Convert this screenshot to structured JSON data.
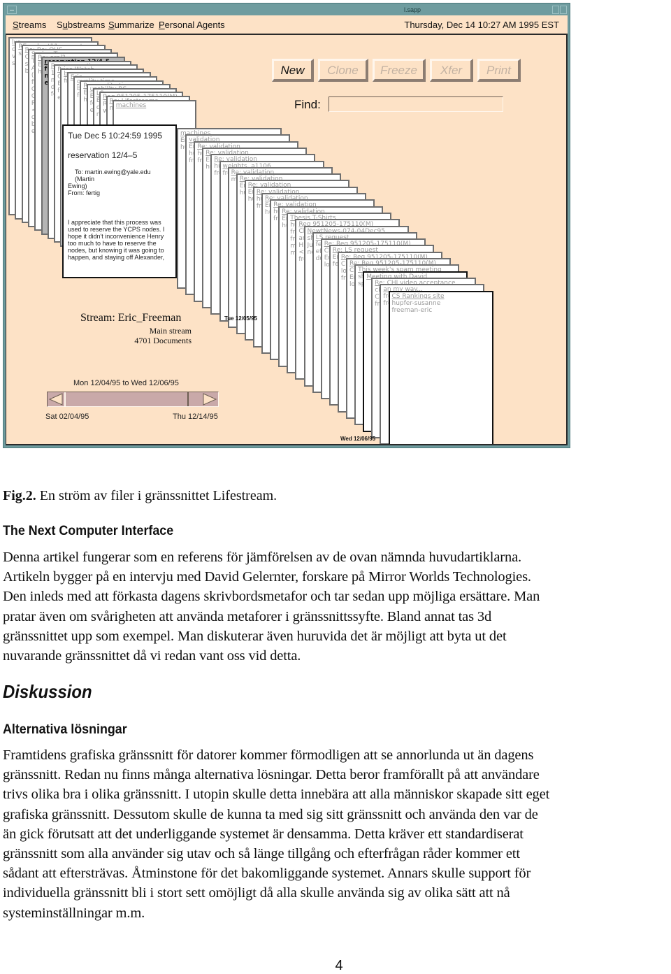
{
  "figure": {
    "window": {
      "title": "l.sapp",
      "menu": [
        {
          "mnemonic": "S",
          "rest": "treams"
        },
        {
          "pre": "S",
          "mnemonic": "u",
          "rest": "bstreams"
        },
        {
          "mnemonic": "S",
          "rest": "ummarize"
        },
        {
          "mnemonic": "P",
          "rest": "ersonal Agents"
        }
      ],
      "clock": "Thursday, Dec 14 10:27 AM 1995 EST"
    },
    "toolbar": {
      "buttons": [
        {
          "label": "New",
          "enabled": true
        },
        {
          "label": "Clone",
          "enabled": false
        },
        {
          "label": "Freeze",
          "enabled": false
        },
        {
          "label": "Xfer",
          "enabled": false
        },
        {
          "label": "Print",
          "enabled": false
        }
      ],
      "find_label": "Find:",
      "find_value": ""
    },
    "stack_cards_past": [
      {
        "lines": [
          "lur",
          "coaler",
          "ve",
          "se"
        ]
      },
      {
        "lines": [
          "RE: robert11 re appt",
          "se wit"
        ]
      },
      {
        "lines": [
          "Re: Re: OUS",
          "Co",
          "sw",
          "be"
        ]
      },
      {
        "lines": [
          "Spring Term",
          "Te",
          "As",
          "(re",
          "fis",
          "CS",
          "Gr",
          "Ra",
          "<ra",
          "cla",
          "bro",
          "exp"
        ]
      },
      {
        "lines": [
          "Re: oral?",
          "Eric",
          "hug"
        ]
      },
      {
        "lines": [
          "reservation 12/4-5",
          "fert",
          "ma",
          "edu"
        ],
        "style": "grey"
      },
      {
        "lines": [
          "Re: reservation",
          "12",
          "ma",
          "da",
          "fe"
        ]
      },
      {
        "lines": [
          "Price Watch",
          "Co",
          "Be",
          "fre",
          "e.a"
        ]
      },
      {
        "lines": [
          "bug",
          "fre"
        ]
      },
      {
        "lines": [
          "Eric"
        ]
      },
      {
        "lines": [
          "quality time",
          "bug",
          "fre"
        ]
      },
      {
        "lines": [
          "Re: quality time",
          "Eric",
          "hug"
        ]
      },
      {
        "lines": [
          "usability RS",
          "Eric",
          "fert",
          "e"
        ]
      },
      {
        "lines": [
          "LS",
          "Eric",
          "cor",
          "nt"
        ]
      },
      {
        "lines": [
          "Reg 951205-175110(M)",
          "Re",
          "wi"
        ]
      },
      {
        "lines": [
          "Re: Lifestreams",
          "machines"
        ]
      },
      {
        "lines": [
          "machines"
        ]
      }
    ],
    "front_card": {
      "date": "Tue Dec  5 10:24:59 1995",
      "subject": "reservation 12/4–5",
      "to_line1": "To: martin.ewing@yale.edu (Martin",
      "to_line2": "Ewing)",
      "from": "From: fertig",
      "body": "I appreciate that this process was used to reserve the YCPS nodes. I hope it didn't inconvenience Henry too much to have to reserve the nodes, but knowing it was going to happen, and staying off Alexander,"
    },
    "stack_cards_future": [
      {
        "lines": [
          "machines",
          "Eric",
          "hug"
        ]
      },
      {
        "lines": [
          "validation",
          "Eric",
          "hug",
          "fre"
        ]
      },
      {
        "lines": [
          "Re: validation",
          "hug",
          "fre"
        ]
      },
      {
        "lines": [
          "Re: validation",
          "Eric",
          "hug"
        ]
      },
      {
        "lines": [
          "Re: validation",
          "hug",
          "fre"
        ]
      },
      {
        "lines": [
          "weights, a1106",
          "fre"
        ]
      },
      {
        "lines": [
          "Re: validation",
          "me"
        ]
      },
      {
        "lines": [
          "Re: validation",
          "Eric",
          "hug"
        ]
      },
      {
        "lines": [
          "Re: validation",
          "Eric",
          "hug"
        ]
      },
      {
        "lines": [
          "Re: validation",
          "hug",
          "fre"
        ]
      },
      {
        "lines": [
          "Re: validation",
          "Eric",
          "hug"
        ]
      },
      {
        "lines": [
          "Re: validation",
          "hug",
          "fre"
        ]
      },
      {
        "lines": [
          "Re: validation",
          "Eric",
          "hug"
        ]
      },
      {
        "lines": [
          "Thesis T-Shirts",
          "hug",
          "fre",
          "fre",
          "ml",
          "m"
        ]
      },
      {
        "lines": [
          "Reg 951205-175110(M)",
          "Cl",
          "an",
          "H.",
          "<lr",
          "fre"
        ]
      },
      {
        "lines": [
          "NewtNews-074-04Dec95",
          "sh",
          "Ju",
          "ne"
        ]
      },
      {
        "lines": [
          "LS request",
          "fer",
          "efr",
          "du"
        ]
      },
      {
        "lines": [
          "Re: Reg 951205-175110(M)",
          "Cl",
          "Eri",
          "lon"
        ]
      },
      {
        "lines": [
          "Re: LS request",
          "Eri",
          "fer"
        ]
      },
      {
        "lines": [
          "Re: Reg 951205-175110(M)",
          "Cl",
          "lon",
          "fre"
        ]
      },
      {
        "lines": [
          "Re: Reg 951205-175110(M)",
          "Cl",
          "Eri",
          "lon"
        ]
      },
      {
        "lines": [
          "This week's spam meeting",
          "sh",
          "sp"
        ]
      },
      {
        "lines": [
          "Meeting with David"
        ],
        "style": "dark"
      },
      {
        "lines": [
          "Re: CHI video acceptance",
          "ch",
          "Ch",
          "fre"
        ]
      },
      {
        "lines": [
          "an my way...",
          "fre",
          "fre"
        ]
      },
      {
        "lines": [
          "CS Rankings site",
          "hupfer-susanne",
          "freeman-eric"
        ],
        "style": "dark"
      }
    ],
    "stream": {
      "name": "Stream: Eric_Freeman",
      "substream": "Main stream",
      "count": "4701 Documents"
    },
    "date_top": "Tue 12/05/95",
    "date_bottom": "Wed 12/06/95",
    "timeline": {
      "range_label": "Mon 12/04/95 to Wed 12/06/95",
      "min_label": "Sat 02/04/95",
      "max_label": "Thu 12/14/95",
      "thumb_position": 0.91
    }
  },
  "document": {
    "caption_bold": "Fig.2.",
    "caption_text": " En ström av filer i gränssnittet Lifestream.",
    "heading1": "The Next Computer Interface",
    "paragraph1_lines": [
      "Denna artikel fungerar som en referens för jämförelsen av de ovan nämnda huvudartiklarna.",
      "Artikeln bygger på en intervju med David Gelernter, forskare på Mirror Worlds Technologies.",
      "Den inleds med att förkasta dagens skrivbordsmetafor och tar sedan upp möjliga ersättare. Man",
      "pratar även om svårigheten att använda metaforer i gränssnittssyfte. Bland annat tas 3d",
      "gränssnittet upp som exempel. Man diskuterar även huruvida det är möjligt att byta ut det",
      "nuvarande gränssnittet då vi redan vant oss vid detta."
    ],
    "heading_section": "Diskussion",
    "heading2": "Alternativa lösningar",
    "paragraph2_lines": [
      "Framtidens grafiska gränssnitt för datorer kommer förmodligen att se annorlunda ut än dagens",
      "gränssnitt. Redan nu finns många alternativa lösningar. Detta beror framförallt på att användare",
      "trivs olika bra i olika gränssnitt. I utopin skulle detta innebära att alla människor skapade sitt eget",
      "grafiska gränssnitt. Dessutom skulle de kunna ta med sig sitt gränssnitt och använda den var de",
      "än gick förutsatt att det underliggande systemet är densamma. Detta kräver ett standardiserat",
      "gränssnitt som alla använder sig utav och så länge tillgång och efterfrågan råder kommer ett",
      "sådant att eftersträvas. Åtminstone för det bakomliggande systemet. Annars skulle support för",
      "individuella gränssnitt bli i stort sett omöjligt då alla skulle använda sig av olika sätt att nå",
      "systeminställningar m.m."
    ],
    "page_number": "4"
  }
}
